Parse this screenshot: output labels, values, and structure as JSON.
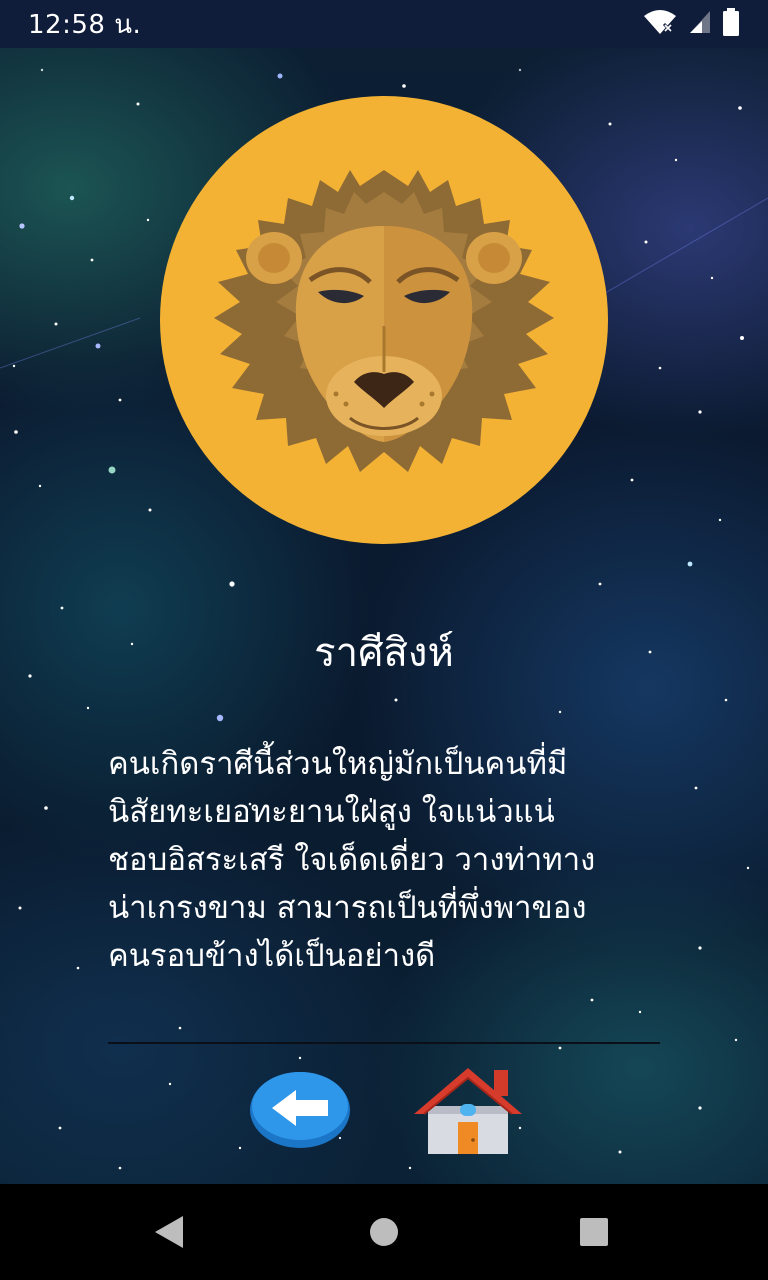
{
  "status_bar": {
    "time": "12:58 น.",
    "icons": [
      "wifi-icon",
      "signal-icon",
      "battery-icon"
    ]
  },
  "sign": {
    "name": "ราศีสิงห์",
    "description": "คนเกิดราศีนี้ส่วนใหญ่มักเป็นคนที่มี\nนิสัยทะเยอทะยานใฝ่สูง ใจแน่วแน่\nชอบอิสระเสรี ใจเด็ดเดี่ยว วางท่าทาง\nน่าเกรงขาม สามารถเป็นที่พึ่งพาของ\nคนรอบข้างได้เป็นอย่างดี",
    "image_icon": "lion-icon",
    "circle_color": "#f3b234"
  },
  "actions": {
    "back_icon": "back-arrow-icon",
    "home_icon": "home-icon"
  },
  "nav": {
    "items": [
      "back-nav-icon",
      "home-nav-icon",
      "recents-nav-icon"
    ]
  }
}
